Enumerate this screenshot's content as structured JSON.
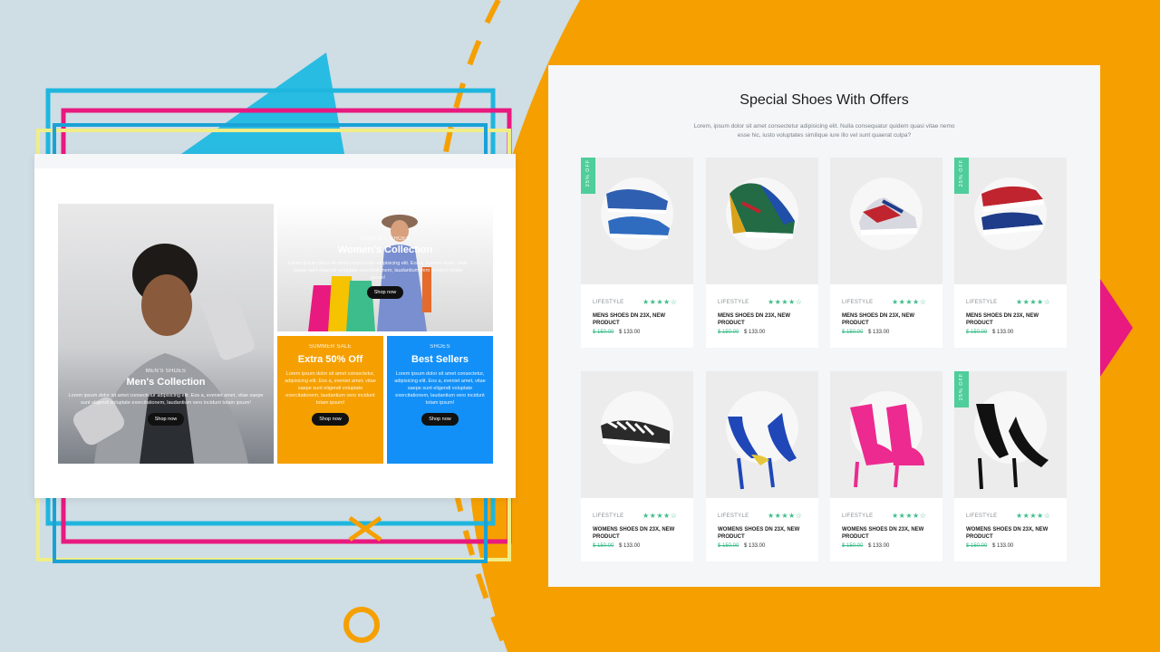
{
  "theme": {
    "orange": "#f5a000",
    "pink": "#e8197f",
    "cyan": "#1fb6de",
    "blue": "#1390f7",
    "green": "#4fcd9a"
  },
  "left_banner": {
    "men": {
      "kicker": "MEN'S SHOES",
      "title": "Men's Collection",
      "text": "Lorem ipsum dolor sit amet consectetur adipisicing elit. Eos a, eveniet amet, vitae saepe sunt eligendi voluptate exercitationem, laudantium vero incidunt totam ipsum!",
      "button": "Shop now"
    },
    "women": {
      "kicker": "WOMEN'S SHOES",
      "title": "Women's Collection",
      "text": "Lorem ipsum dolor sit amet consectetur adipisicing elit. Eos a, eveniet amet, vitae saepe sunt eligendi voluptate exercitationem, laudantium vero incidunt totam ipsum!",
      "button": "Shop now"
    },
    "sale": {
      "kicker": "SUMMER SALE",
      "title": "Extra 50% Off",
      "text": "Lorem ipsum dolor sit amet consectetur, adipisicing elit. Eos a, eveniet amet, vitae saepe sunt eligendi voluptate exercitationem, laudantium vero incidunt totam ipsum!",
      "button": "Shop now"
    },
    "best": {
      "kicker": "SHOES",
      "title": "Best Sellers",
      "text": "Lorem ipsum dolor sit amet consectetur, adipisicing elit. Eos a, eveniet amet, vitae saepe sunt eligendi voluptate exercitationem, laudantium vero incidunt totam ipsum!",
      "button": "Shop now"
    }
  },
  "offers": {
    "title": "Special Shoes With Offers",
    "subtitle": "Lorem, ipsum dolor sit amet consectetur adipisicing elit. Nulla consequatur quidem quasi vitae nemo esse hic, iusto voluptates similique iure illo vel sunt quaerat culpa?",
    "offer_badge": "25% OFF",
    "stars": "★★★★☆",
    "products": [
      {
        "category": "LIFESTYLE",
        "name": "MENS SHOES DN 23X, NEW PRODUCT",
        "old_price": "$ 150.00",
        "price": "$ 133.00",
        "badge": true,
        "icon": "blue-sneaker-image"
      },
      {
        "category": "LIFESTYLE",
        "name": "MENS SHOES DN 23X, NEW PRODUCT",
        "old_price": "$ 150.00",
        "price": "$ 133.00",
        "badge": false,
        "icon": "skate-sneaker-image"
      },
      {
        "category": "LIFESTYLE",
        "name": "MENS SHOES DN 23X, NEW PRODUCT",
        "old_price": "$ 150.00",
        "price": "$ 133.00",
        "badge": false,
        "icon": "running-sneaker-image"
      },
      {
        "category": "LIFESTYLE",
        "name": "MENS SHOES DN 23X, NEW PRODUCT",
        "old_price": "$ 150.00",
        "price": "$ 133.00",
        "badge": true,
        "icon": "canvas-sneaker-image"
      },
      {
        "category": "LIFESTYLE",
        "name": "WOMENS SHOES DN 23X, NEW PRODUCT",
        "old_price": "$ 150.00",
        "price": "$ 133.00",
        "badge": false,
        "icon": "checkered-slipon-image"
      },
      {
        "category": "LIFESTYLE",
        "name": "WOMENS SHOES DN 23X, NEW PRODUCT",
        "old_price": "$ 150.00",
        "price": "$ 133.00",
        "badge": false,
        "icon": "blue-heels-image"
      },
      {
        "category": "LIFESTYLE",
        "name": "WOMENS SHOES DN 23X, NEW PRODUCT",
        "old_price": "$ 150.00",
        "price": "$ 133.00",
        "badge": false,
        "icon": "pink-booties-image"
      },
      {
        "category": "LIFESTYLE",
        "name": "WOMENS SHOES DN 23X, NEW PRODUCT",
        "old_price": "$ 150.00",
        "price": "$ 133.00",
        "badge": true,
        "icon": "black-heels-image"
      }
    ]
  }
}
